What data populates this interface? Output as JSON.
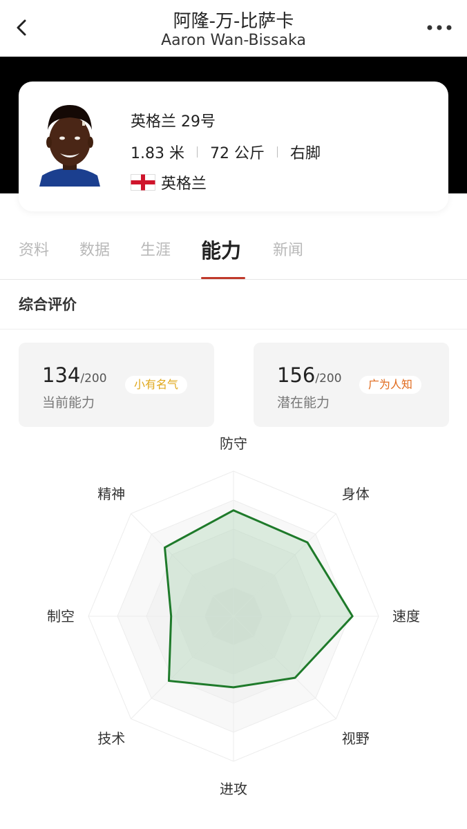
{
  "header": {
    "title_cn": "阿隆-万-比萨卡",
    "title_en": "Aaron Wan-Bissaka"
  },
  "profile": {
    "team_number": "英格兰 29号",
    "height": "1.83 米",
    "weight": "72 公斤",
    "foot": "右脚",
    "nationality": "英格兰"
  },
  "tabs": [
    {
      "label": "资料",
      "active": false
    },
    {
      "label": "数据",
      "active": false
    },
    {
      "label": "生涯",
      "active": false
    },
    {
      "label": "能力",
      "active": true
    },
    {
      "label": "新闻",
      "active": false
    }
  ],
  "section": {
    "title": "综合评价"
  },
  "ratings": {
    "current": {
      "value": "134",
      "max": "/200",
      "label": "当前能力",
      "badge": "小有名气",
      "badge_color": "#e0a81c"
    },
    "potential": {
      "value": "156",
      "max": "/200",
      "label": "潜在能力",
      "badge": "广为人知",
      "badge_color": "#e06a1c"
    }
  },
  "colors": {
    "accent": "#c0392b",
    "radar_line": "#1e7a2a",
    "radar_fill": "rgba(120,190,130,0.22)"
  },
  "chart_data": {
    "type": "radar",
    "categories": [
      "防守",
      "身体",
      "速度",
      "视野",
      "进攻",
      "技术",
      "制空",
      "精神"
    ],
    "values": [
      73,
      72,
      82,
      60,
      49,
      63,
      43,
      67
    ],
    "max": 100,
    "rings": 5
  }
}
